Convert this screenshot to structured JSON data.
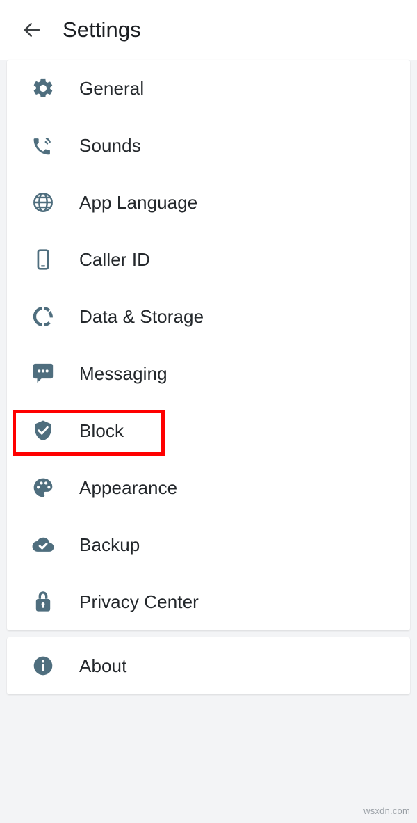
{
  "header": {
    "back_icon": "arrow-left-icon",
    "title": "Settings"
  },
  "theme": {
    "icon_color": "#4f6e7e",
    "text_color": "#24282c",
    "card_background": "#ffffff",
    "page_background": "#f3f4f6",
    "highlight_color": "#ff0000"
  },
  "primary_group": {
    "items": [
      {
        "label": "General",
        "icon": "gear-icon"
      },
      {
        "label": "Sounds",
        "icon": "phone-in-talk-icon"
      },
      {
        "label": "App Language",
        "icon": "globe-icon"
      },
      {
        "label": "Caller ID",
        "icon": "smartphone-icon"
      },
      {
        "label": "Data & Storage",
        "icon": "data-usage-circle-icon"
      },
      {
        "label": "Messaging",
        "icon": "chat-bubble-icon"
      },
      {
        "label": "Block",
        "icon": "shield-check-icon"
      },
      {
        "label": "Appearance",
        "icon": "palette-icon"
      },
      {
        "label": "Backup",
        "icon": "cloud-check-icon"
      },
      {
        "label": "Privacy Center",
        "icon": "lock-icon"
      }
    ]
  },
  "secondary_group": {
    "items": [
      {
        "label": "About",
        "icon": "info-circle-icon"
      }
    ]
  },
  "annotation": {
    "target_label": "Block",
    "color": "#ff0000"
  },
  "watermark": {
    "text": "wsxdn.com"
  }
}
